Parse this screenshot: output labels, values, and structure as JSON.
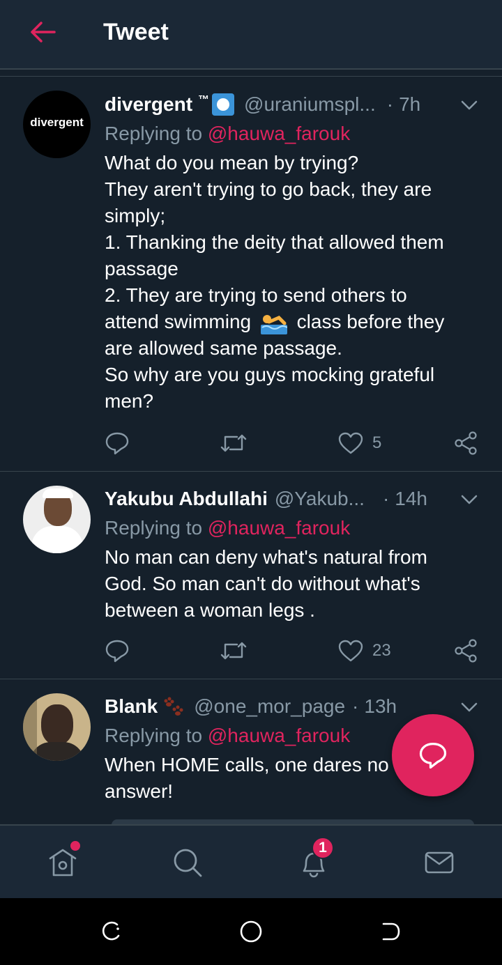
{
  "header": {
    "title": "Tweet"
  },
  "tweets": [
    {
      "name": "divergent",
      "tm": "™",
      "handle": "@uraniumspl...",
      "dot": "·",
      "time": "7h",
      "replying_prefix": "Replying to",
      "replying_to": "@hauwa_farouk",
      "avatar_text": "divergent",
      "body_lines": [
        "What do you mean by trying?",
        "They aren't trying to go back, they are",
        "simply;",
        "1. Thanking the deity that allowed them",
        "passage",
        "2. They are trying to send others to",
        "attend swimming",
        "class before they",
        "are allowed same passage.",
        "So why are you guys mocking grateful",
        "men?"
      ],
      "likes": "5"
    },
    {
      "name": "Yakubu Abdullahi",
      "handle": "@Yakub...",
      "dot": "·",
      "time": "14h",
      "replying_prefix": "Replying to",
      "replying_to": "@hauwa_farouk",
      "body_lines": [
        "No man can deny what's natural  from",
        "God. So man can't do without what's",
        "between a  woman legs ."
      ],
      "likes": "23"
    },
    {
      "name": "Blank",
      "handle": "@one_mor_page",
      "dot": "·",
      "time": "13h",
      "replying_prefix": "Replying to",
      "replying_to": "@hauwa_farouk",
      "body_lines": [
        "When HOME calls, one dares no",
        "answer!"
      ]
    }
  ],
  "tabs": {
    "notifications_badge": "1"
  },
  "colors": {
    "accent": "#e0245e",
    "background": "#15202b",
    "muted": "#8899a6"
  }
}
